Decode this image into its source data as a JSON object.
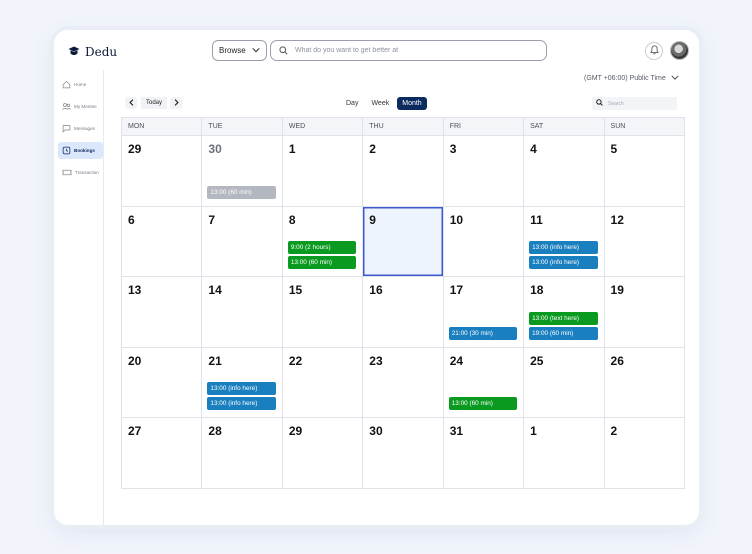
{
  "app": {
    "name": "Dedu"
  },
  "header": {
    "browse_label": "Browse",
    "search_placeholder": "What do you want to get better at"
  },
  "sidebar": {
    "items": [
      {
        "label": "Home",
        "icon": "home-icon",
        "active": false
      },
      {
        "label": "My Mentee",
        "icon": "users-icon",
        "active": false
      },
      {
        "label": "Messages",
        "icon": "message-icon",
        "active": false
      },
      {
        "label": "Bookings",
        "icon": "clock-icon",
        "active": true
      },
      {
        "label": "Transaction",
        "icon": "ticket-icon",
        "active": false
      }
    ]
  },
  "calendar": {
    "timezone": "(GMT +06:00) Public Time",
    "today_label": "Today",
    "views": [
      {
        "label": "Day",
        "active": false
      },
      {
        "label": "Week",
        "active": false
      },
      {
        "label": "Month",
        "active": true
      }
    ],
    "search_placeholder": "Search",
    "weekdays": [
      "MON",
      "TUE",
      "WED",
      "THU",
      "FRI",
      "SAT",
      "SUN"
    ],
    "colors": {
      "green": "#0a9a1f",
      "blue": "#1a7fbf",
      "grey": "#b3b8c0",
      "selected_border": "#3d5bd0",
      "primary": "#0b2a5e"
    },
    "weeks": [
      [
        {
          "day": "29",
          "events": []
        },
        {
          "day": "30",
          "muted": true,
          "events": [
            {
              "label": "13:00 (60 min)",
              "color": "grey"
            }
          ]
        },
        {
          "day": "1",
          "events": []
        },
        {
          "day": "2",
          "events": []
        },
        {
          "day": "3",
          "events": []
        },
        {
          "day": "4",
          "events": []
        },
        {
          "day": "5",
          "events": []
        }
      ],
      [
        {
          "day": "6",
          "events": []
        },
        {
          "day": "7",
          "events": []
        },
        {
          "day": "8",
          "events": [
            {
              "label": "9:00 (2 hours)",
              "color": "green"
            },
            {
              "label": "13:00 (60 min)",
              "color": "green"
            }
          ]
        },
        {
          "day": "9",
          "selected": true,
          "events": []
        },
        {
          "day": "10",
          "events": []
        },
        {
          "day": "11",
          "events": [
            {
              "label": "13:00 (info here)",
              "color": "blue"
            },
            {
              "label": "13:00 (info here)",
              "color": "blue"
            }
          ]
        },
        {
          "day": "12",
          "events": []
        }
      ],
      [
        {
          "day": "13",
          "events": []
        },
        {
          "day": "14",
          "events": []
        },
        {
          "day": "15",
          "events": []
        },
        {
          "day": "16",
          "events": []
        },
        {
          "day": "17",
          "events": [
            {
              "label": "21:00 (30 min)",
              "color": "blue"
            }
          ]
        },
        {
          "day": "18",
          "events": [
            {
              "label": "13:00 (text here)",
              "color": "green"
            },
            {
              "label": "19:00 (60 min)",
              "color": "blue"
            }
          ]
        },
        {
          "day": "19",
          "events": []
        }
      ],
      [
        {
          "day": "20",
          "events": []
        },
        {
          "day": "21",
          "events": [
            {
              "label": "13:00 (info here)",
              "color": "blue"
            },
            {
              "label": "13:00 (info here)",
              "color": "blue"
            }
          ]
        },
        {
          "day": "22",
          "events": []
        },
        {
          "day": "23",
          "events": []
        },
        {
          "day": "24",
          "events": [
            {
              "label": "13:00 (60 min)",
              "color": "green"
            }
          ]
        },
        {
          "day": "25",
          "events": []
        },
        {
          "day": "26",
          "events": []
        }
      ],
      [
        {
          "day": "27",
          "events": []
        },
        {
          "day": "28",
          "events": []
        },
        {
          "day": "29",
          "events": []
        },
        {
          "day": "30",
          "events": []
        },
        {
          "day": "31",
          "events": []
        },
        {
          "day": "1",
          "events": []
        },
        {
          "day": "2",
          "events": []
        }
      ]
    ]
  }
}
